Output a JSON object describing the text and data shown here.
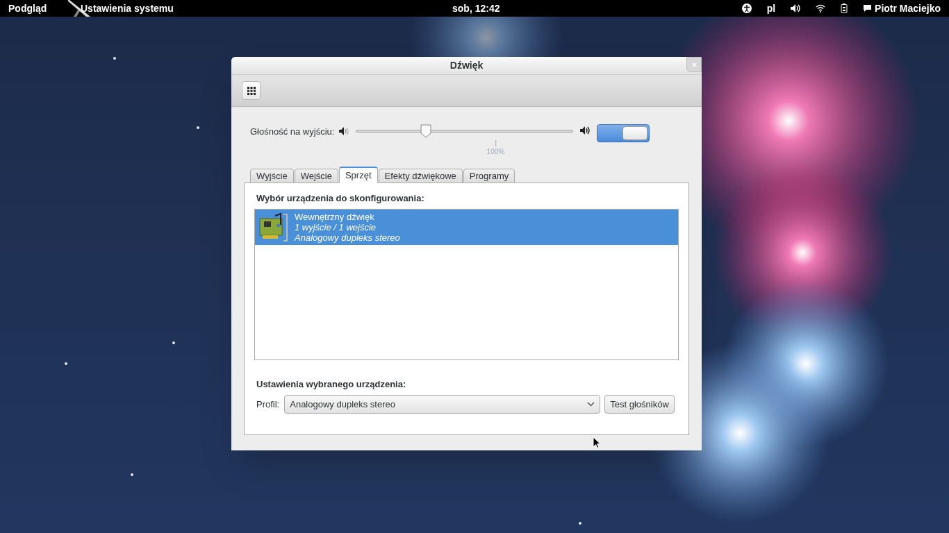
{
  "top_bar": {
    "activities": "Podgląd",
    "app_menu": "Ustawienia systemu",
    "clock": "sob, 12:42",
    "keyboard_layout": "pl",
    "user": "Piotr Maciejko"
  },
  "window": {
    "title": "Dźwięk",
    "output_volume": {
      "label": "Głośność na wyjściu:",
      "level": 0.32,
      "mark": "100%",
      "switch_on": true
    },
    "tabs": [
      {
        "label": "Wyjście",
        "selected": false
      },
      {
        "label": "Wejście",
        "selected": false
      },
      {
        "label": "Sprzęt",
        "selected": true
      },
      {
        "label": "Efekty dźwiękowe",
        "selected": false
      },
      {
        "label": "Programy",
        "selected": false
      }
    ],
    "device_heading": "Wybór urządzenia do skonfigurowania:",
    "devices": [
      {
        "name": "Wewnętrzny dźwięk",
        "ports": "1 wyjście / 1 wejście",
        "profile": "Analogowy dupleks stereo",
        "selected": true
      }
    ],
    "settings_heading": "Ustawienia wybranego urządzenia:",
    "profile_label": "Profil:",
    "profile_value": "Analogowy dupleks stereo",
    "test_button": "Test głośników"
  }
}
